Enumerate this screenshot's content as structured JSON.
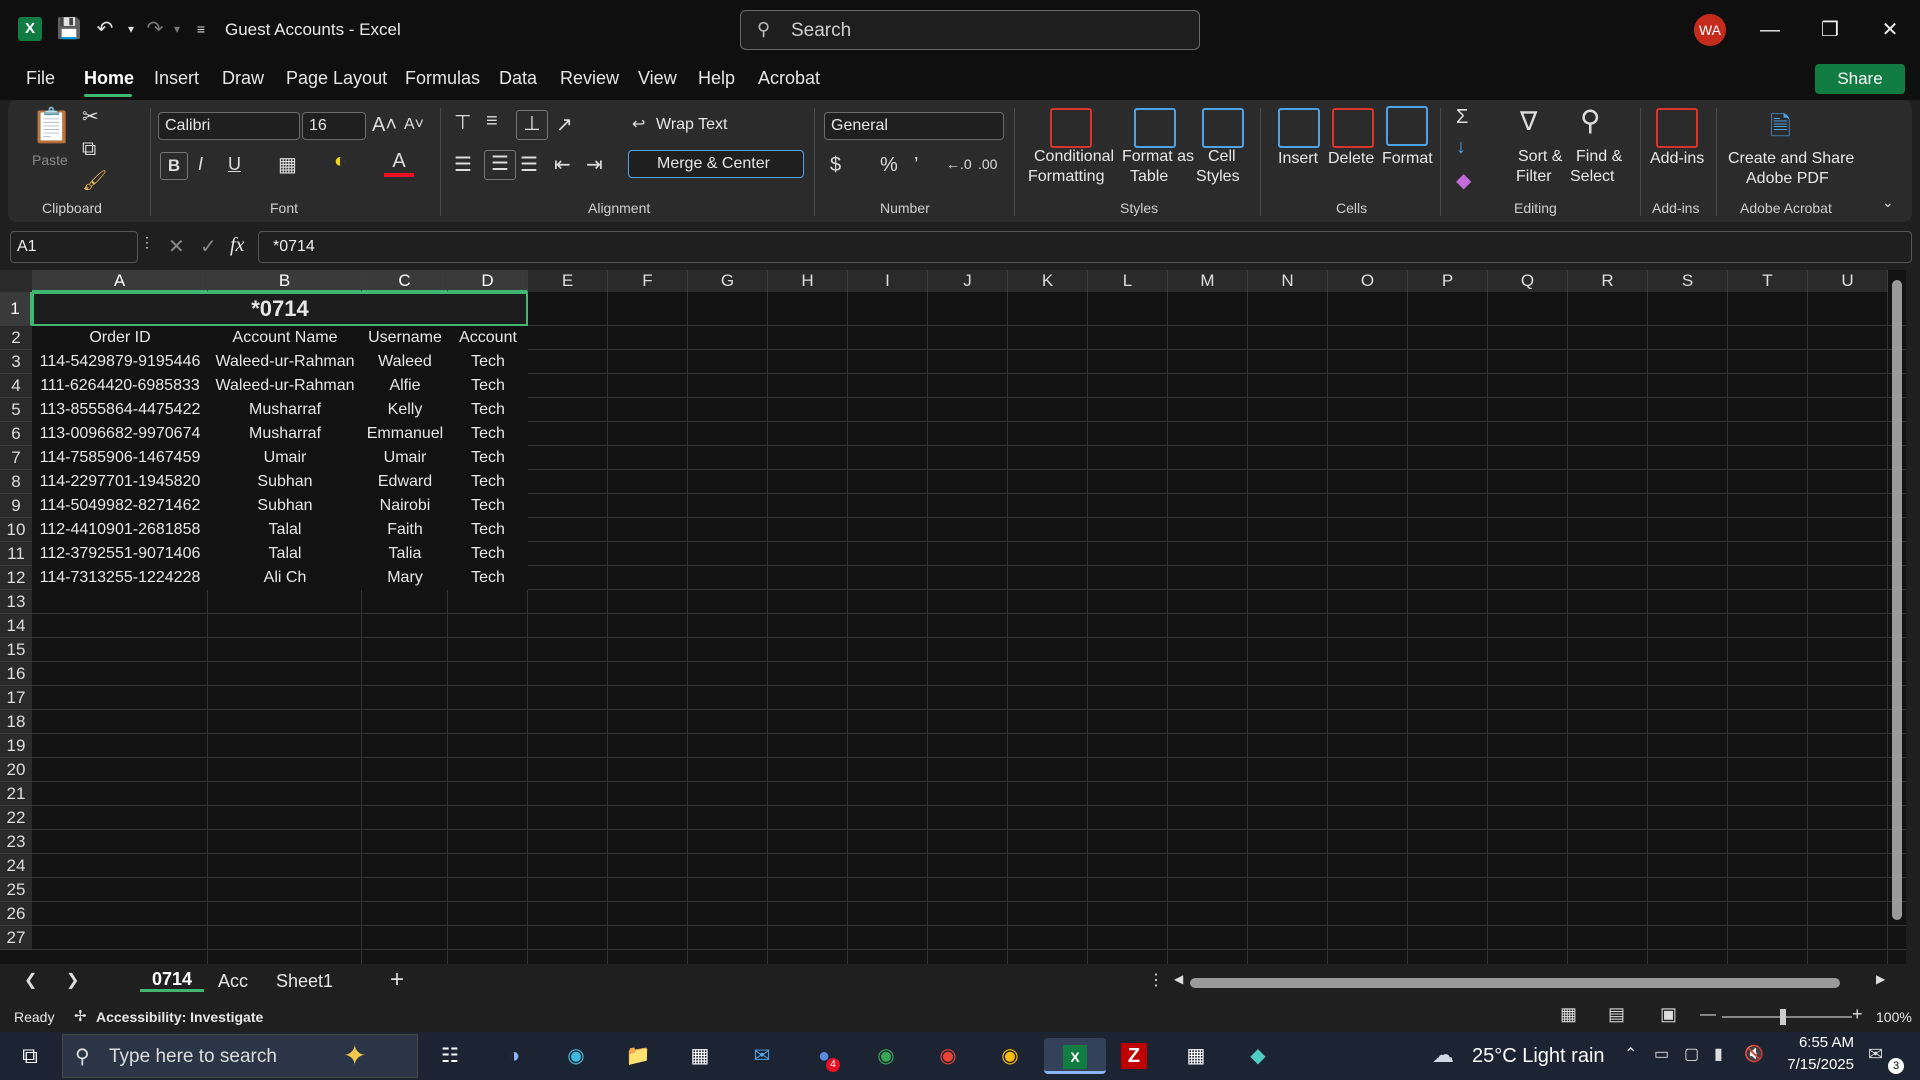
{
  "titlebar": {
    "title": "Guest Accounts  -  Excel",
    "search_placeholder": "Search",
    "avatar_initials": "WA"
  },
  "tabs": [
    "File",
    "Home",
    "Insert",
    "Draw",
    "Page Layout",
    "Formulas",
    "Data",
    "Review",
    "View",
    "Help",
    "Acrobat"
  ],
  "share_label": "Share",
  "ribbon": {
    "clipboard": {
      "paste": "Paste",
      "group": "Clipboard"
    },
    "font": {
      "name": "Calibri",
      "size": "16",
      "group": "Font"
    },
    "alignment": {
      "wrap": "Wrap Text",
      "merge": "Merge & Center",
      "group": "Alignment"
    },
    "number": {
      "format": "General",
      "group": "Number"
    },
    "styles": {
      "conditional1": "Conditional",
      "conditional2": "Formatting",
      "fat1": "Format as",
      "fat2": "Table",
      "cs1": "Cell",
      "cs2": "Styles",
      "group": "Styles"
    },
    "cells": {
      "insert": "Insert",
      "delete": "Delete",
      "format": "Format",
      "group": "Cells"
    },
    "editing": {
      "sort1": "Sort &",
      "sort2": "Filter",
      "find1": "Find &",
      "find2": "Select",
      "group": "Editing"
    },
    "addins": {
      "label": "Add-ins",
      "group": "Add-ins"
    },
    "acrobat": {
      "l1": "Create and Share",
      "l2": "Adobe PDF",
      "group": "Adobe Acrobat"
    }
  },
  "formula_bar": {
    "name_box": "A1",
    "fx": "fx",
    "value": "*0714"
  },
  "grid": {
    "columns": [
      "A",
      "B",
      "C",
      "D",
      "E",
      "F",
      "G",
      "H",
      "I",
      "J",
      "K",
      "L",
      "M",
      "N",
      "O",
      "P",
      "Q",
      "R",
      "S",
      "T",
      "U"
    ],
    "rows": [
      "1",
      "2",
      "3",
      "4",
      "5",
      "6",
      "7",
      "8",
      "9",
      "10",
      "11",
      "12",
      "13",
      "14",
      "15",
      "16",
      "17",
      "18",
      "19",
      "20",
      "21",
      "22",
      "23",
      "24",
      "25",
      "26",
      "27"
    ],
    "title": "*0714",
    "headers": [
      "Order ID",
      "Account Name",
      "Username",
      "Account"
    ],
    "data": [
      [
        "114-5429879-9195446",
        "Waleed-ur-Rahman",
        "Waleed",
        "Tech"
      ],
      [
        "111-6264420-6985833",
        "Waleed-ur-Rahman",
        "Alfie",
        "Tech"
      ],
      [
        "113-8555864-4475422",
        "Musharraf",
        "Kelly",
        "Tech"
      ],
      [
        "113-0096682-9970674",
        "Musharraf",
        "Emmanuel",
        "Tech"
      ],
      [
        "114-7585906-1467459",
        "Umair",
        "Umair",
        "Tech"
      ],
      [
        "114-2297701-1945820",
        "Subhan",
        "Edward",
        "Tech"
      ],
      [
        "114-5049982-8271462",
        "Subhan",
        "Nairobi",
        "Tech"
      ],
      [
        "112-4410901-2681858",
        "Talal",
        "Faith",
        "Tech"
      ],
      [
        "112-3792551-9071406",
        "Talal",
        "Talia",
        "Tech"
      ],
      [
        "114-7313255-1224228",
        "Ali Ch",
        "Mary",
        "Tech"
      ]
    ]
  },
  "sheets": [
    "0714",
    "Acc",
    "Sheet1"
  ],
  "status": {
    "ready": "Ready",
    "accessibility": "Accessibility: Investigate",
    "zoom": "100%"
  },
  "taskbar": {
    "search_placeholder": "Type here to search",
    "weather": "25°C  Light rain",
    "time": "6:55 AM",
    "date": "7/15/2025",
    "notif": "3",
    "badge": "4"
  },
  "colors": {
    "excel_green": "#107c41",
    "accent": "#3fb771",
    "avatar": "#c42b1c"
  }
}
